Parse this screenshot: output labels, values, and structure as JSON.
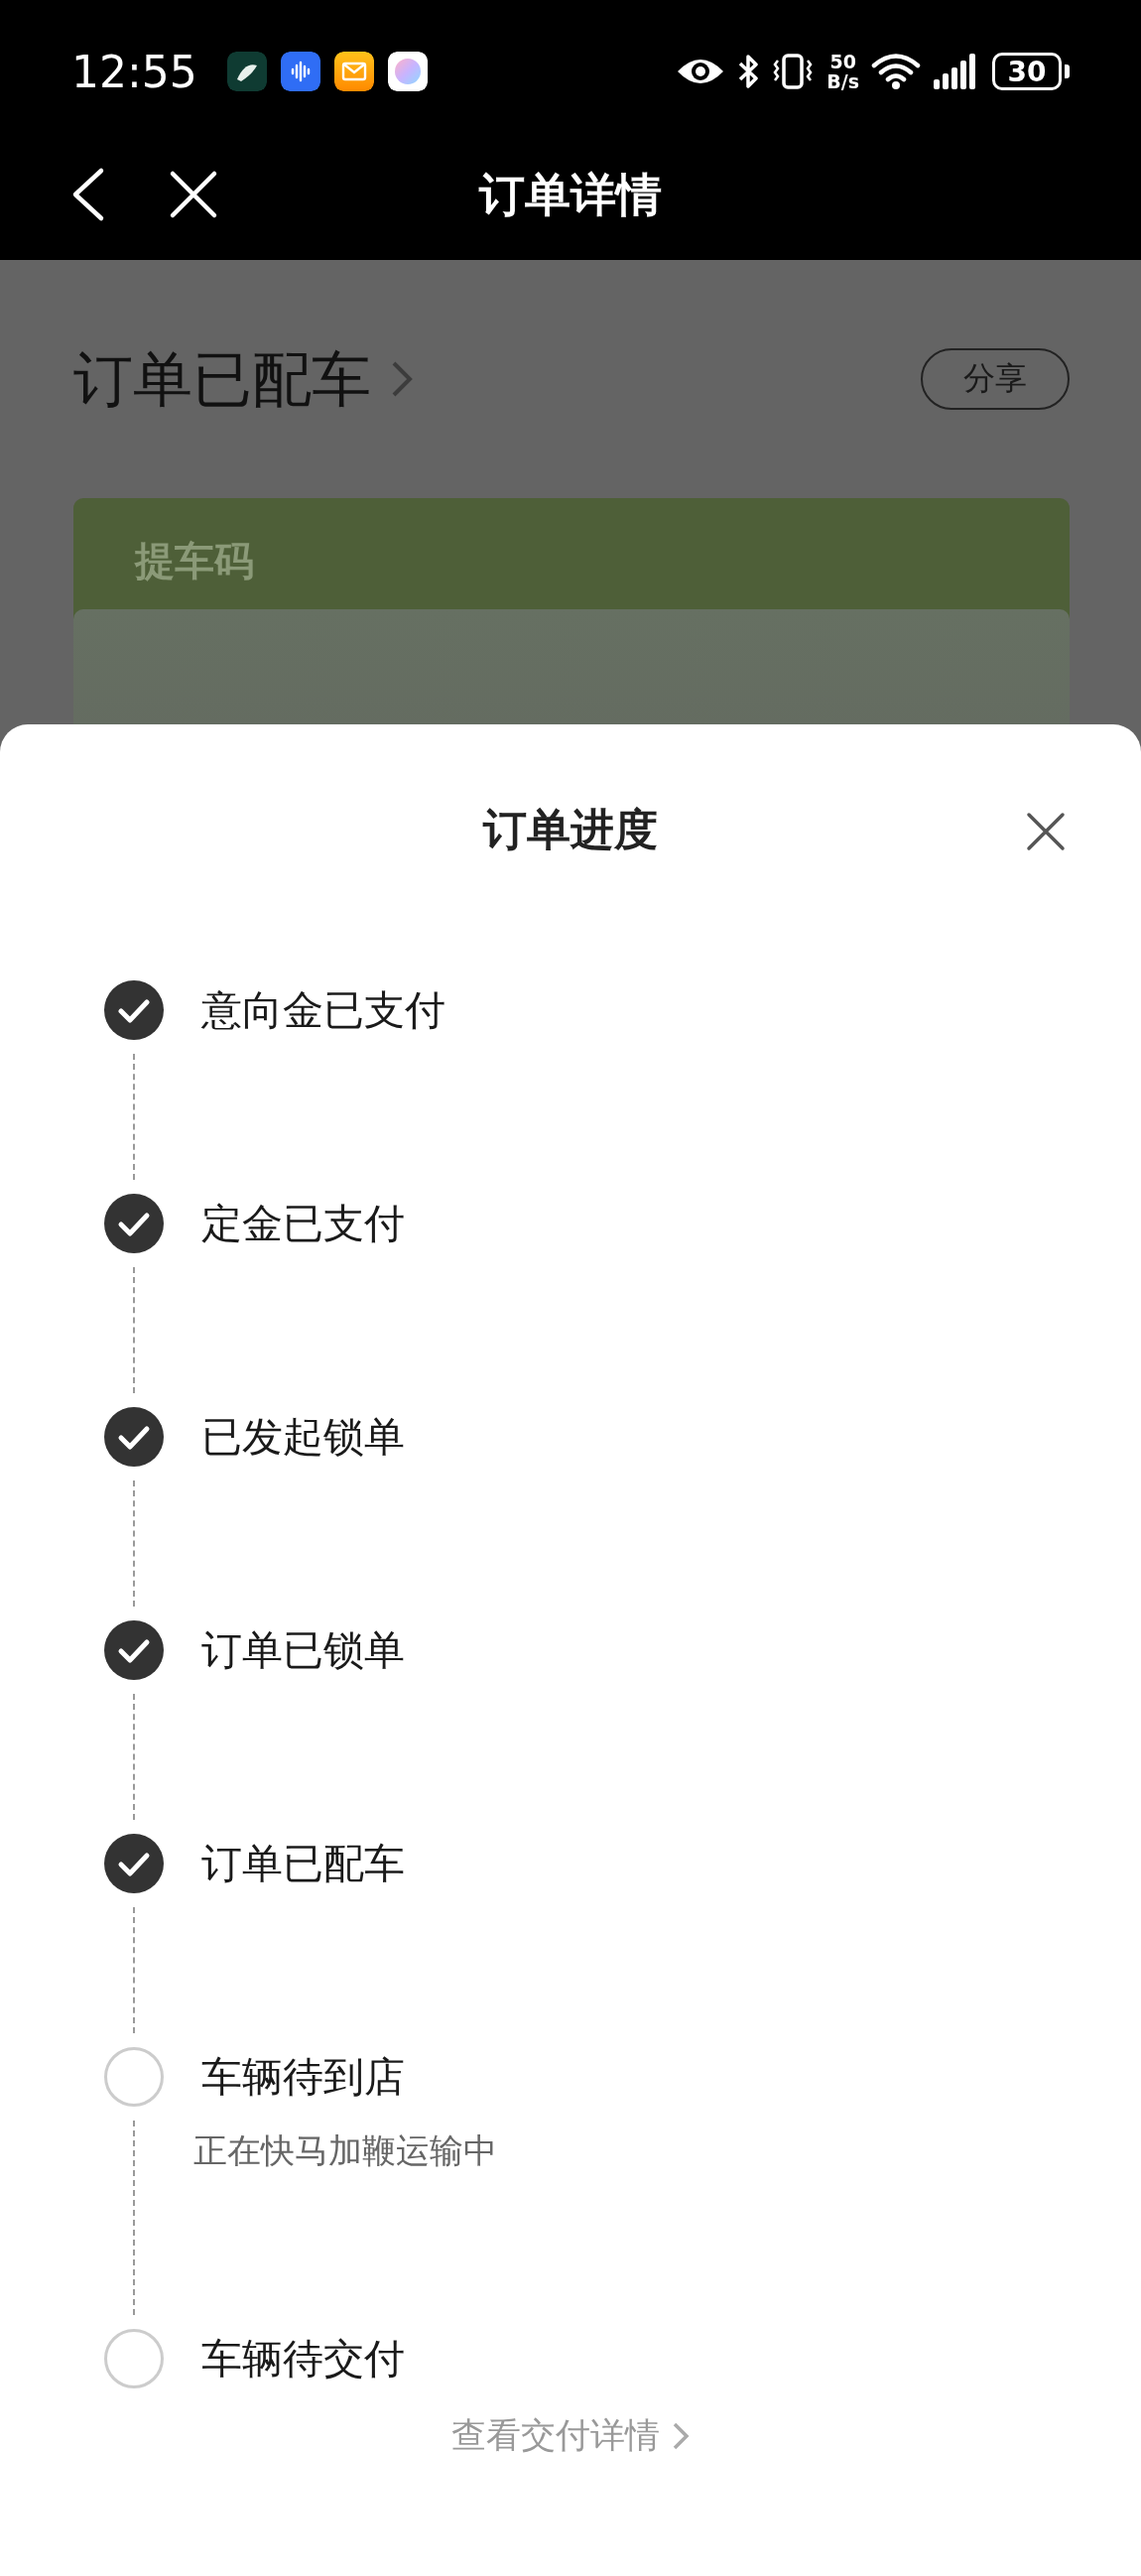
{
  "status_bar": {
    "time": "12:55",
    "net_speed_value": "50",
    "net_speed_unit": "B/s",
    "battery": "30"
  },
  "nav": {
    "title": "订单详情"
  },
  "order": {
    "status": "订单已配车",
    "share": "分享",
    "card_title": "提车码"
  },
  "sheet": {
    "title": "订单进度",
    "steps": [
      {
        "label": "意向金已支付",
        "done": true
      },
      {
        "label": "定金已支付",
        "done": true
      },
      {
        "label": "已发起锁单",
        "done": true
      },
      {
        "label": "订单已锁单",
        "done": true
      },
      {
        "label": "订单已配车",
        "done": true
      },
      {
        "label": "车辆待到店",
        "done": false,
        "note": "正在快马加鞭运输中"
      },
      {
        "label": "车辆待交付",
        "done": false
      }
    ],
    "footer_link": "查看交付详情"
  }
}
